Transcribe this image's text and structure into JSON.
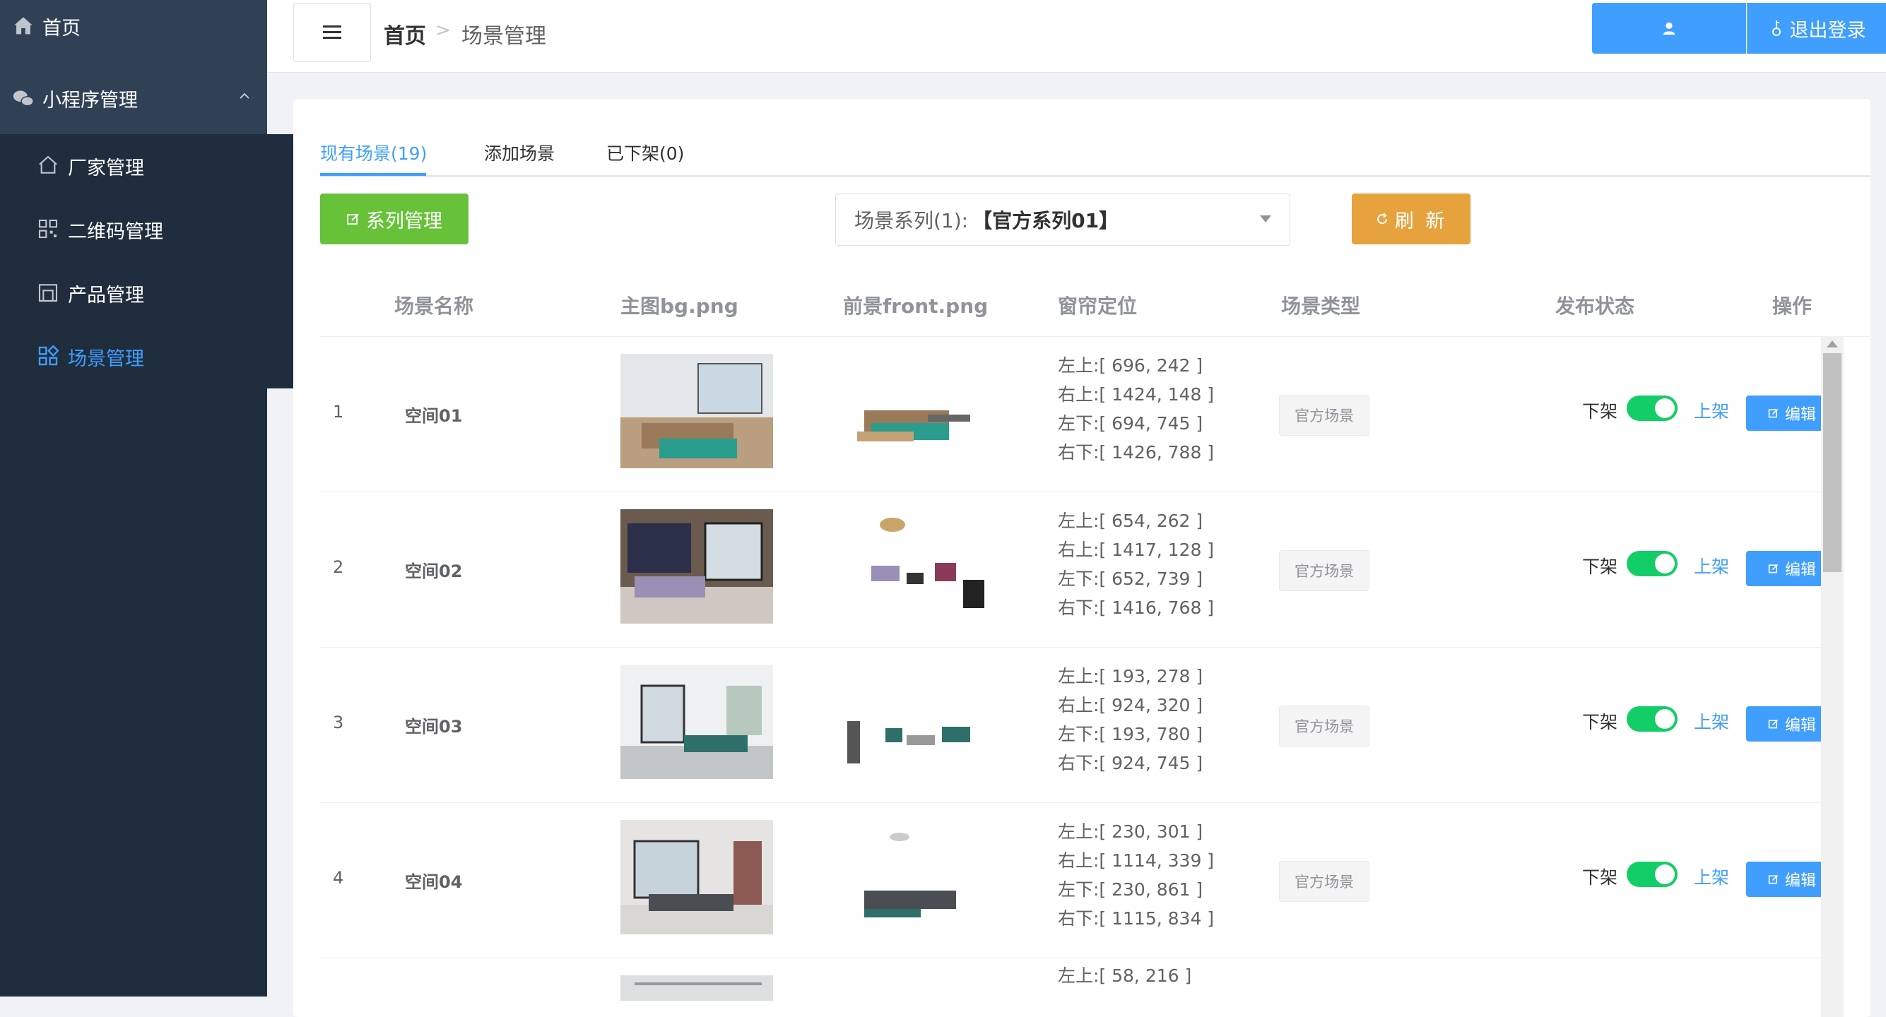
{
  "sidebar": {
    "home": "首页",
    "miniapp": "小程序管理",
    "items": [
      {
        "label": "厂家管理",
        "icon": "home-outline-icon"
      },
      {
        "label": "二维码管理",
        "icon": "qrcode-icon"
      },
      {
        "label": "产品管理",
        "icon": "store-icon"
      },
      {
        "label": "场景管理",
        "icon": "grid-icon"
      }
    ]
  },
  "breadcrumb": {
    "home": "首页",
    "current": "场景管理"
  },
  "header": {
    "user_label": "",
    "logout_label": "退出登录"
  },
  "tabs": [
    {
      "label": "现有场景(19)"
    },
    {
      "label": "添加场景"
    },
    {
      "label": "已下架(0)"
    }
  ],
  "toolbar": {
    "series_button": "系列管理",
    "select_label": "场景系列(1):",
    "select_value": "【官方系列01】",
    "refresh_button": "刷 新"
  },
  "table": {
    "headers": [
      "场景名称",
      "主图bg.png",
      "前景front.png",
      "窗帘定位",
      "场景类型",
      "发布状态",
      "操作"
    ],
    "rows": [
      {
        "index": "1",
        "name": "空间01",
        "coords": [
          "左上:[ 696, 242 ]",
          "右上:[ 1424, 148 ]",
          "左下:[ 694, 745 ]",
          "右下:[ 1426, 788 ]"
        ],
        "type": "官方场景",
        "off": "下架",
        "on": "上架",
        "edit": "编辑"
      },
      {
        "index": "2",
        "name": "空间02",
        "coords": [
          "左上:[ 654, 262 ]",
          "右上:[ 1417, 128 ]",
          "左下:[ 652, 739 ]",
          "右下:[ 1416, 768 ]"
        ],
        "type": "官方场景",
        "off": "下架",
        "on": "上架",
        "edit": "编辑"
      },
      {
        "index": "3",
        "name": "空间03",
        "coords": [
          "左上:[ 193, 278 ]",
          "右上:[ 924, 320 ]",
          "左下:[ 193, 780 ]",
          "右下:[ 924, 745 ]"
        ],
        "type": "官方场景",
        "off": "下架",
        "on": "上架",
        "edit": "编辑"
      },
      {
        "index": "4",
        "name": "空间04",
        "coords": [
          "左上:[ 230, 301 ]",
          "右上:[ 1114, 339 ]",
          "左下:[ 230, 861 ]",
          "右下:[ 1115, 834 ]"
        ],
        "type": "官方场景",
        "off": "下架",
        "on": "上架",
        "edit": "编辑"
      },
      {
        "index": "",
        "name": "",
        "coords": [
          "左上:[ 58, 216 ]"
        ],
        "type": "",
        "off": "",
        "on": "",
        "edit": ""
      }
    ]
  },
  "colors": {
    "sidebar": "#304156",
    "primary": "#409eff",
    "success": "#67c23a",
    "warning": "#e6a23c",
    "switch": "#13ce66"
  }
}
